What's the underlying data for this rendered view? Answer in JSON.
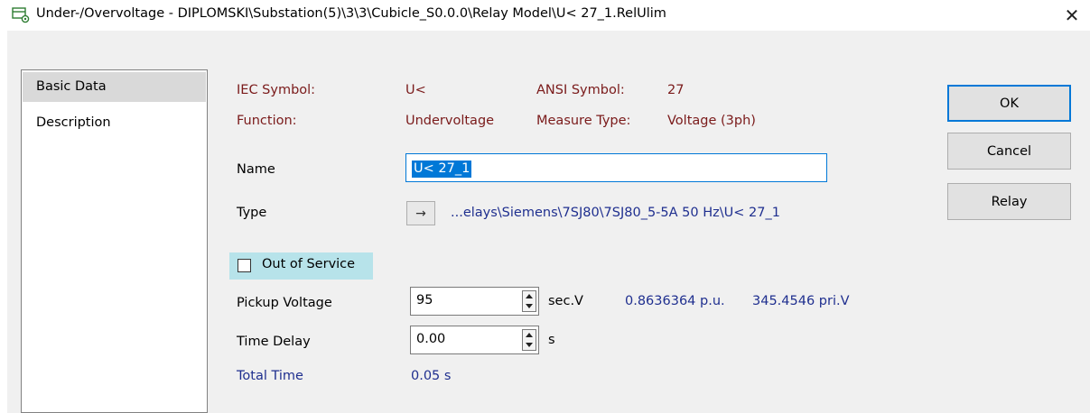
{
  "window": {
    "title": "Under-/Overvoltage - DIPLOMSKI\\Substation(5)\\3\\3\\Cubicle_S0.0.0\\Relay Model\\U< 27_1.RelUlim",
    "close_glyph": "✕"
  },
  "sidebar": {
    "items": [
      {
        "label": "Basic Data",
        "selected": true
      },
      {
        "label": "Description",
        "selected": false
      }
    ]
  },
  "info": {
    "iec_label": "IEC Symbol:",
    "iec_value": "U<",
    "ansi_label": "ANSI Symbol:",
    "ansi_value": "27",
    "function_label": "Function:",
    "function_value": "Undervoltage",
    "measure_label": "Measure Type:",
    "measure_value": "Voltage (3ph)"
  },
  "form": {
    "name_label": "Name",
    "name_value": "U< 27_1",
    "type_label": "Type",
    "type_arrow": "→",
    "type_value": "...elays\\Siemens\\7SJ80\\7SJ80_5-5A 50 Hz\\U< 27_1",
    "out_of_service_label": "Out of Service",
    "out_of_service_checked": false,
    "pickup_label": "Pickup Voltage",
    "pickup_value": "95",
    "pickup_unit": "sec.V",
    "pickup_pu": "0.8636364 p.u.",
    "pickup_pri": "345.4546 pri.V",
    "delay_label": "Time Delay",
    "delay_value": "0.00",
    "delay_unit": "s",
    "total_label": "Total Time",
    "total_value": "0.05 s"
  },
  "buttons": {
    "ok": "OK",
    "cancel": "Cancel",
    "relay": "Relay"
  },
  "colors": {
    "accent": "#0078d7",
    "label_red": "#7a1a1a",
    "label_blue": "#1f2f8f",
    "highlight": "#b7e3ea"
  }
}
